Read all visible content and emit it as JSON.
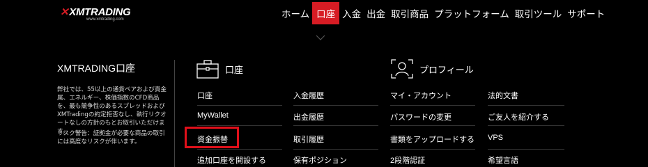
{
  "brand": {
    "logo_text": "XMTRADING",
    "logo_url_text": "www.xmtrading.com",
    "accent_color": "#d71c24"
  },
  "nav": {
    "items": [
      {
        "label": "ホーム",
        "active": false
      },
      {
        "label": "口座",
        "active": true
      },
      {
        "label": "入金",
        "active": false
      },
      {
        "label": "出金",
        "active": false
      },
      {
        "label": "取引商品",
        "active": false
      },
      {
        "label": "プラットフォーム",
        "active": false
      },
      {
        "label": "取引ツール",
        "active": false
      },
      {
        "label": "サポート",
        "active": false
      }
    ]
  },
  "panel": {
    "title": "XMTRADING口座",
    "description": "弊社では、55以上の通貨ペアおよび貴金属、エネルギー、株価指数のCFD商品を、最も競争性のあるスプレッドおよびXMTradingの約定拒否なし、執行リクオートなしの方針のもとお取引いただけます。",
    "risk_warning": "リスク警告：証拠金が必要な商品の取引には高度なリスクが伴います。"
  },
  "account_section": {
    "heading": "口座",
    "icon": "briefcase-icon",
    "col1": [
      "口座",
      "MyWallet",
      "資金振替",
      "追加口座を開設する"
    ],
    "col2": [
      "入金履歴",
      "出金履歴",
      "取引履歴",
      "保有ポジション"
    ]
  },
  "profile_section": {
    "heading": "プロフィール",
    "icon": "user-profile-icon",
    "col1": [
      "マイ・アカウント",
      "パスワードの変更",
      "書類をアップロードする",
      "2段階認証"
    ],
    "col2": [
      "法的文書",
      "ご友人を紹介する",
      "VPS",
      "希望言語"
    ]
  },
  "highlight": {
    "target": "資金振替",
    "color": "#e0101a"
  }
}
